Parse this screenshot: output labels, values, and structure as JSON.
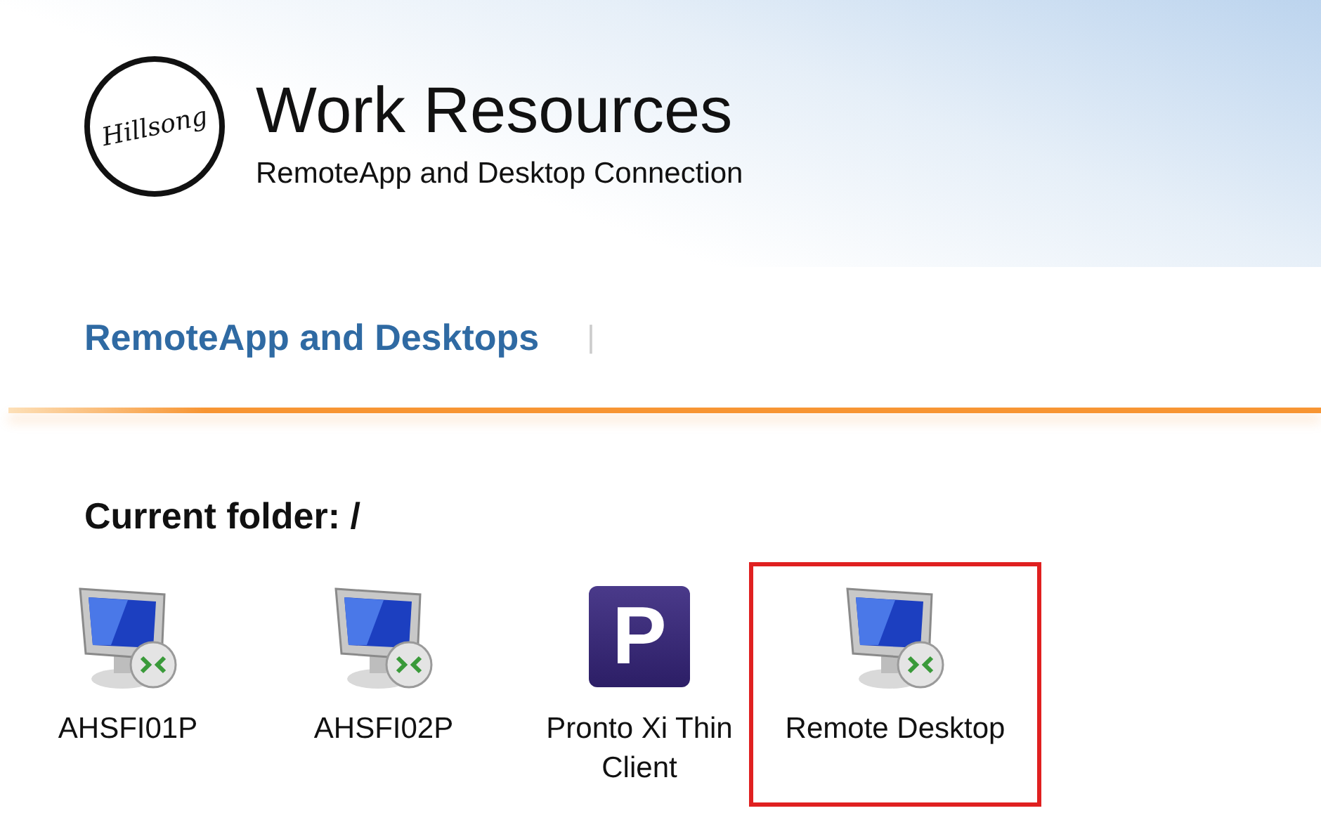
{
  "logo": {
    "text": "Hillsong"
  },
  "header": {
    "title": "Work Resources",
    "subtitle": "RemoteApp and Desktop Connection"
  },
  "nav": {
    "tabs": [
      {
        "label": "RemoteApp and Desktops",
        "selected": true
      }
    ],
    "separator": "|"
  },
  "folder": {
    "label": "Current folder: /"
  },
  "items": [
    {
      "label": "AHSFI01P",
      "kind": "desktop",
      "highlighted": false
    },
    {
      "label": "AHSFI02P",
      "kind": "desktop",
      "highlighted": false
    },
    {
      "label": "Pronto Xi Thin Client",
      "kind": "app",
      "icon_text": "P",
      "highlighted": false
    },
    {
      "label": "Remote Desktop",
      "kind": "desktop",
      "highlighted": true
    }
  ]
}
